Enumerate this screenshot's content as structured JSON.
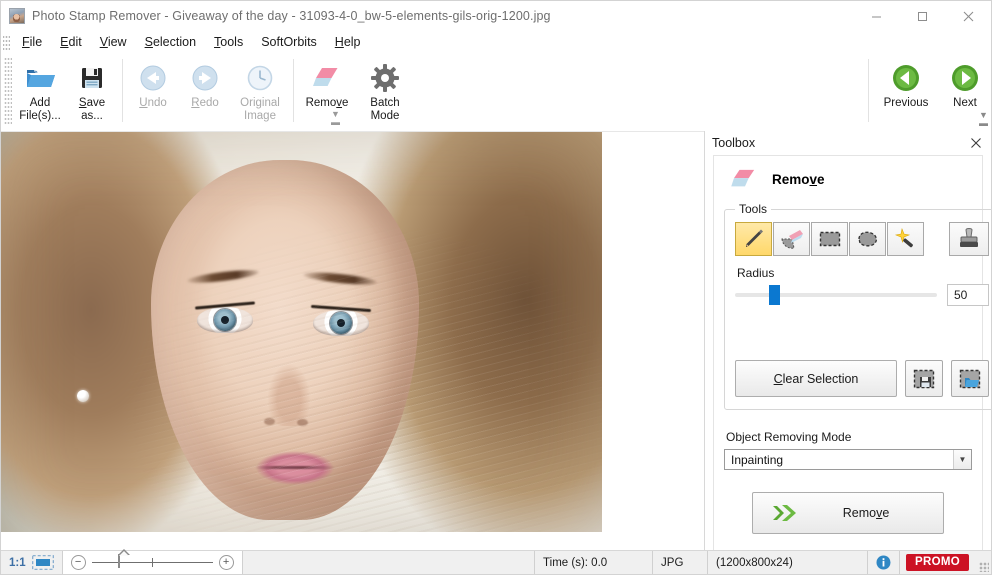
{
  "window": {
    "title": "Photo Stamp Remover - Giveaway of the day - 31093-4-0_bw-5-elements-gils-orig-1200.jpg",
    "app_icon": "photo-icon",
    "minimize_label": "Minimize",
    "maximize_label": "Maximize",
    "close_label": "Close"
  },
  "menubar": {
    "items": [
      {
        "label": "File",
        "accel": "F"
      },
      {
        "label": "Edit",
        "accel": "E"
      },
      {
        "label": "View",
        "accel": "V"
      },
      {
        "label": "Selection",
        "accel": "S"
      },
      {
        "label": "Tools",
        "accel": "T"
      },
      {
        "label": "SoftOrbits",
        "accel": ""
      },
      {
        "label": "Help",
        "accel": "H"
      }
    ]
  },
  "toolbar": {
    "add_files_label": "Add\nFile(s)...",
    "save_as_label": "Save\nas...",
    "undo_label": "Undo",
    "redo_label": "Redo",
    "original_image_label": "Original\nImage",
    "remove_label": "Remove",
    "batch_mode_label": "Batch\nMode",
    "previous_label": "Previous",
    "next_label": "Next",
    "overflow_label": "More commands",
    "icons": {
      "add_files": "open-folder-icon",
      "save_as": "floppy-disk-icon",
      "undo": "arrow-left-circle-icon",
      "redo": "arrow-right-circle-icon",
      "original_image": "clock-icon",
      "remove": "eraser-icon",
      "batch_mode": "gear-icon",
      "previous": "green-left-arrow-icon",
      "next": "green-right-arrow-icon"
    },
    "disabled": [
      "undo",
      "redo",
      "original_image"
    ]
  },
  "toolbox": {
    "panel_title": "Toolbox",
    "close_label": "Close toolbox",
    "mode_title": "Remove",
    "mode_accel": "v",
    "tools_group_label": "Tools",
    "tools": [
      {
        "name": "pencil",
        "icon": "pencil-icon",
        "active": true
      },
      {
        "name": "eraser",
        "icon": "eraser-brush-icon",
        "active": false
      },
      {
        "name": "rectangle",
        "icon": "rectangle-select-icon",
        "active": false
      },
      {
        "name": "lasso",
        "icon": "lasso-icon",
        "active": false
      },
      {
        "name": "magic-wand",
        "icon": "magic-wand-icon",
        "active": false
      }
    ],
    "stamp_tool": {
      "name": "stamp",
      "icon": "stamp-icon",
      "active": false
    },
    "radius_label": "Radius",
    "radius_value": "50",
    "radius_min": "0",
    "radius_max": "200",
    "clear_selection_label": "Clear Selection",
    "clear_selection_accel": "C",
    "save_selection_icon": "save-selection-icon",
    "load_selection_icon": "load-selection-icon",
    "object_removing_mode_label": "Object Removing Mode",
    "object_removing_mode_value": "Inpainting",
    "object_removing_mode_options": [
      "Inpainting"
    ],
    "remove_button_label": "Remove",
    "remove_button_accel": "v",
    "remove_button_icon": "green-double-arrow-icon"
  },
  "statusbar": {
    "zoom_ratio": "1:1",
    "fit_icon": "fit-to-window-icon",
    "zoom_out_label": "−",
    "zoom_in_label": "+",
    "time_label": "Time (s): 0.0",
    "format_label": "JPG",
    "dimensions_label": "(1200x800x24)",
    "info_icon": "info-icon",
    "promo_label": "PROMO"
  },
  "colors": {
    "accent_blue": "#0b78d0",
    "promo_red": "#cc1224",
    "active_tool_yellow": "#ffd86a",
    "green_arrow": "#5aa832",
    "titlebar_text": "#6e6e6e"
  },
  "canvas": {
    "image_alt": "portrait-photo",
    "image_width": "1200",
    "image_height": "800"
  }
}
